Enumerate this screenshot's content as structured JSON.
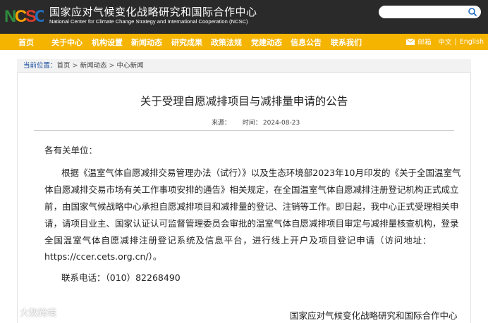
{
  "header": {
    "org_name_cn": "国家应对气候变化战略研究和国际合作中心",
    "org_name_en": "National Center for Climate Change Strategy and International Cooperation (NCSC)",
    "logo_text": "NCSC",
    "search_placeholder": ""
  },
  "nav": {
    "items": [
      {
        "label": "首页"
      },
      {
        "label": "关于中心"
      },
      {
        "label": "机构设置"
      },
      {
        "label": "新闻动态"
      },
      {
        "label": "研究成果"
      },
      {
        "label": "政策法规"
      },
      {
        "label": "党建动态"
      },
      {
        "label": "信息公告"
      },
      {
        "label": "联系我们"
      }
    ],
    "mail_label": "邮箱",
    "lang_cn": "中文",
    "lang_sep": "|",
    "lang_en": "English"
  },
  "breadcrumb": {
    "label": "当前位置：",
    "items": [
      "首页",
      "新闻动态",
      "中心新闻"
    ],
    "separator": ">"
  },
  "article": {
    "title": "关于受理自愿减排项目与减排量申请的公告",
    "source_label": "来源：",
    "time_label": "时间：",
    "time_value": "2024-08-23",
    "salutation": "各有关单位：",
    "body_lines": [
      "根据《温室气体自愿减排交易管理办法（试行）》以及生态环境部2023年10月印发的《关于全国温室气",
      "体自愿减排交易市场有关工作事项安排的通告》相关规定，在全国温室气体自愿减排注册登记机构正式成立",
      "前，由国家气候战略中心承担自愿减排项目和减排量的登记、注销等工作。即日起，我中心正式受理相关申",
      "请，请项目业主、国家认证认可监督管理委员会审批的温室气体自愿减排项目审定与减排量核查机构，登录",
      "全国温室气体自愿减排注册登记系统及信息平台，进行线上开户及项目登记申请（访问地址：",
      "https://ccer.cets.org.cn/）。"
    ],
    "contact": "联系电话：（010）82268490",
    "signature": "国家应对气候变化战略研究和国际合作中心"
  },
  "watermark": {
    "text": "大数跨境"
  },
  "colors": {
    "header_bg": "#2a2a2a",
    "nav_bg": "#f5b400",
    "breadcrumb_label": "#1a4fa0",
    "logo_n": "#2e8b3d",
    "logo_c": "#f5a000",
    "logo_s": "#d83b2e",
    "logo_c2": "#1f6fc0"
  }
}
